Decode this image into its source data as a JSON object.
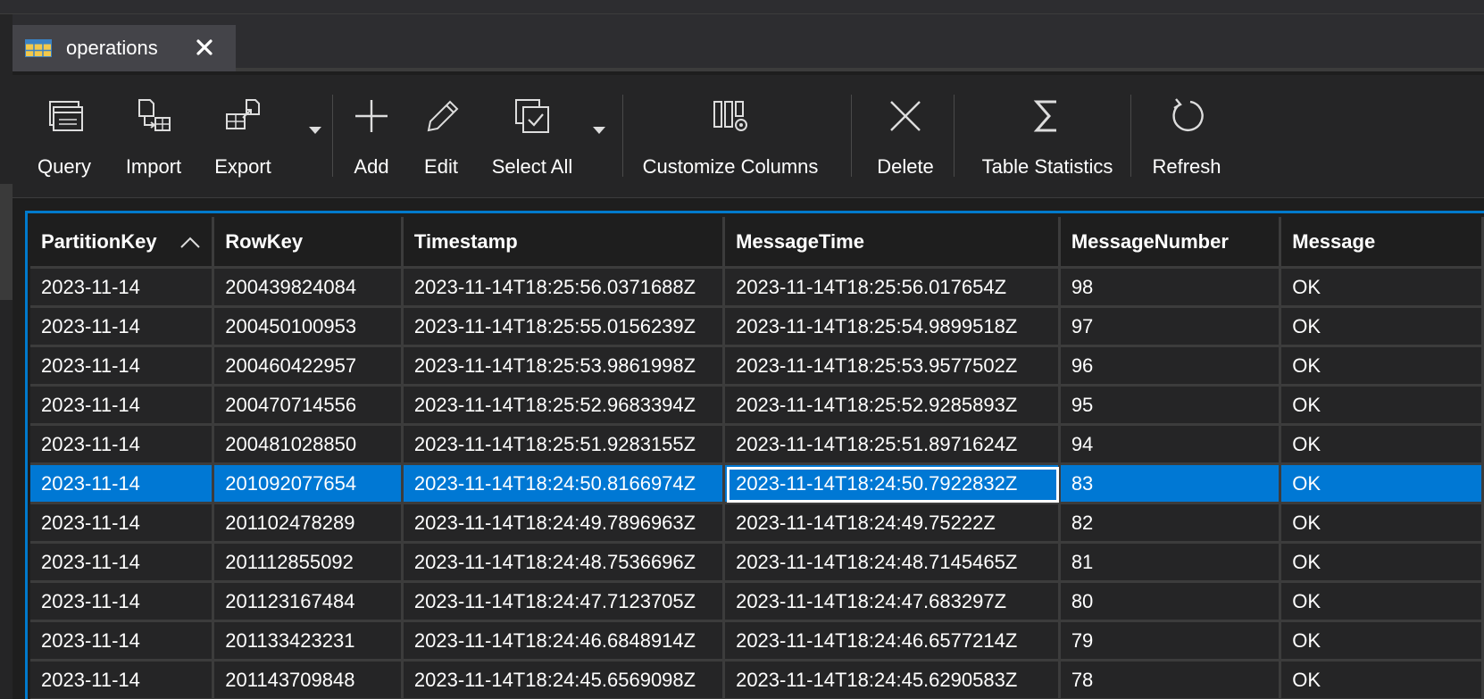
{
  "tab": {
    "label": "operations",
    "icon": "table-icon",
    "close_icon": "close-icon"
  },
  "toolbar": {
    "query": "Query",
    "import": "Import",
    "export": "Export",
    "add": "Add",
    "edit": "Edit",
    "select_all": "Select All",
    "customize_columns": "Customize Columns",
    "delete": "Delete",
    "table_statistics": "Table Statistics",
    "refresh": "Refresh"
  },
  "table": {
    "columns": [
      "PartitionKey",
      "RowKey",
      "Timestamp",
      "MessageTime",
      "MessageNumber",
      "Message"
    ],
    "sort_column": "PartitionKey",
    "sort_direction": "ascending",
    "selected_row": 5,
    "focused_column": 3,
    "rows": [
      [
        "2023-11-14",
        "200439824084",
        "2023-11-14T18:25:56.0371688Z",
        "2023-11-14T18:25:56.017654Z",
        "98",
        "OK"
      ],
      [
        "2023-11-14",
        "200450100953",
        "2023-11-14T18:25:55.0156239Z",
        "2023-11-14T18:25:54.9899518Z",
        "97",
        "OK"
      ],
      [
        "2023-11-14",
        "200460422957",
        "2023-11-14T18:25:53.9861998Z",
        "2023-11-14T18:25:53.9577502Z",
        "96",
        "OK"
      ],
      [
        "2023-11-14",
        "200470714556",
        "2023-11-14T18:25:52.9683394Z",
        "2023-11-14T18:25:52.9285893Z",
        "95",
        "OK"
      ],
      [
        "2023-11-14",
        "200481028850",
        "2023-11-14T18:25:51.9283155Z",
        "2023-11-14T18:25:51.8971624Z",
        "94",
        "OK"
      ],
      [
        "2023-11-14",
        "201092077654",
        "2023-11-14T18:24:50.8166974Z",
        "2023-11-14T18:24:50.7922832Z",
        "83",
        "OK"
      ],
      [
        "2023-11-14",
        "201102478289",
        "2023-11-14T18:24:49.7896963Z",
        "2023-11-14T18:24:49.75222Z",
        "82",
        "OK"
      ],
      [
        "2023-11-14",
        "201112855092",
        "2023-11-14T18:24:48.7536696Z",
        "2023-11-14T18:24:48.7145465Z",
        "81",
        "OK"
      ],
      [
        "2023-11-14",
        "201123167484",
        "2023-11-14T18:24:47.7123705Z",
        "2023-11-14T18:24:47.683297Z",
        "80",
        "OK"
      ],
      [
        "2023-11-14",
        "201133423231",
        "2023-11-14T18:24:46.6848914Z",
        "2023-11-14T18:24:46.6577214Z",
        "79",
        "OK"
      ],
      [
        "2023-11-14",
        "201143709848",
        "2023-11-14T18:24:45.6569098Z",
        "2023-11-14T18:24:45.6290583Z",
        "78",
        "OK"
      ]
    ]
  },
  "colors": {
    "accent": "#007acc",
    "selection": "#0078d4",
    "background": "#1e1e1e",
    "row": "#252526",
    "grid": "#3c3c3c"
  }
}
